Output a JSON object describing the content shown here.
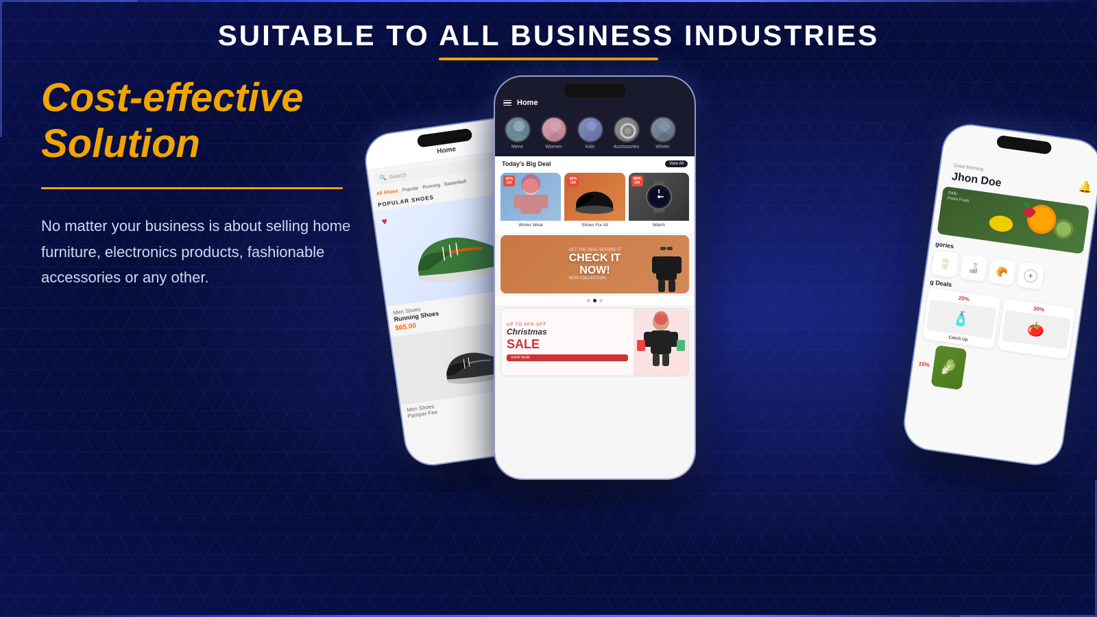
{
  "header": {
    "title": "SUITABLE TO ALL BUSINESS INDUSTRIES"
  },
  "left": {
    "headline_line1": "Cost-effective",
    "headline_line2": "Solution",
    "description": "No matter your business is about selling home furniture, electronics products, fashionable accessories or any other."
  },
  "phone_left": {
    "app_title": "Home",
    "search_placeholder": "Search",
    "filters": [
      "All Shoes",
      "Popular",
      "Running",
      "Basketball"
    ],
    "popular_label": "POPULAR SHOES",
    "product1": {
      "category": "Men Shoes",
      "name": "Running Shoes",
      "price": "$65.00"
    },
    "product2": {
      "category": "Men Shoes",
      "name": "Pamper Fee"
    }
  },
  "phone_center": {
    "app_title": "Home",
    "categories": [
      {
        "label": "Mens"
      },
      {
        "label": "Women"
      },
      {
        "label": "Kids"
      },
      {
        "label": "Accessories"
      },
      {
        "label": "Winter"
      }
    ],
    "deals_section_title": "Today's Big Deal",
    "view_all_label": "View All",
    "deals": [
      {
        "label": "Winter Wear",
        "badge": "40% Off"
      },
      {
        "label": "Shoes For All",
        "badge": "40% Off"
      },
      {
        "label": "Watch",
        "badge": "40% Off"
      }
    ],
    "promo_banner": {
      "line1": "CHECK IT",
      "line2": "NOW!",
      "sub": "NEW COLLECTION"
    },
    "xmas_banner": {
      "off_text": "UP TO 50% OFF",
      "title": "Christmas",
      "sale": "SALE",
      "shop": "SHOP NOW"
    }
  },
  "phone_right": {
    "greeting": "Good Morning",
    "username": "Jhon Doe",
    "fresh_banner": {
      "label": "Daily\nFresh Fruits"
    },
    "categories_title": "gories",
    "deals_title": "g Deals",
    "catch_up_label": "Catch Up",
    "discount1": "20%",
    "discount2": "30%",
    "discount3": "15%"
  },
  "colors": {
    "background": "#0a1150",
    "accent_gold": "#f0a500",
    "text_white": "#ffffff",
    "text_light": "#d0d8f0",
    "accent_red": "#cc3333",
    "accent_orange": "#ff6600",
    "phone_dark": "#1a1a2e"
  }
}
